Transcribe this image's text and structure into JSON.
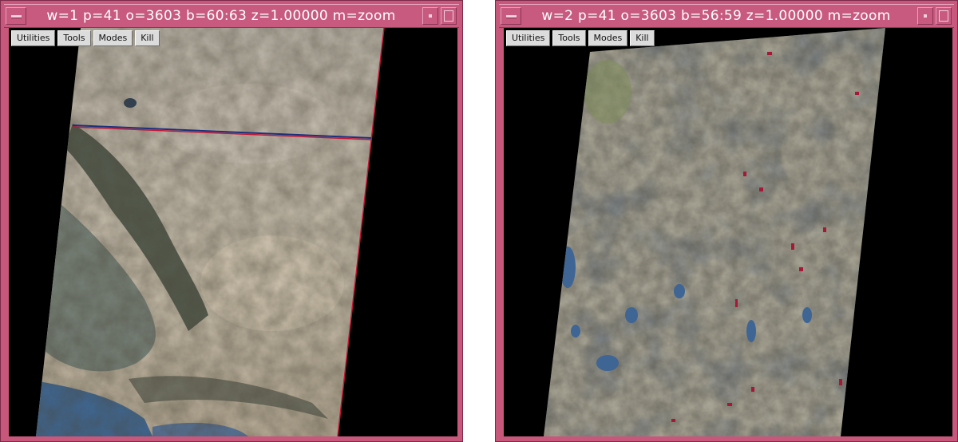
{
  "windows": [
    {
      "title": "w=1  p=41  o=3603  b=60:63  z=1.00000  m=zoom",
      "toolbar": [
        "Utilities",
        "Tools",
        "Modes",
        "Kill"
      ]
    },
    {
      "title": "w=2  p=41  o=3603  b=56:59  z=1.00000  m=zoom",
      "toolbar": [
        "Utilities",
        "Tools",
        "Modes",
        "Kill"
      ]
    }
  ],
  "colors": {
    "frame": "#c8577c",
    "titlebar": "#c75a7e",
    "background": "#000000"
  }
}
